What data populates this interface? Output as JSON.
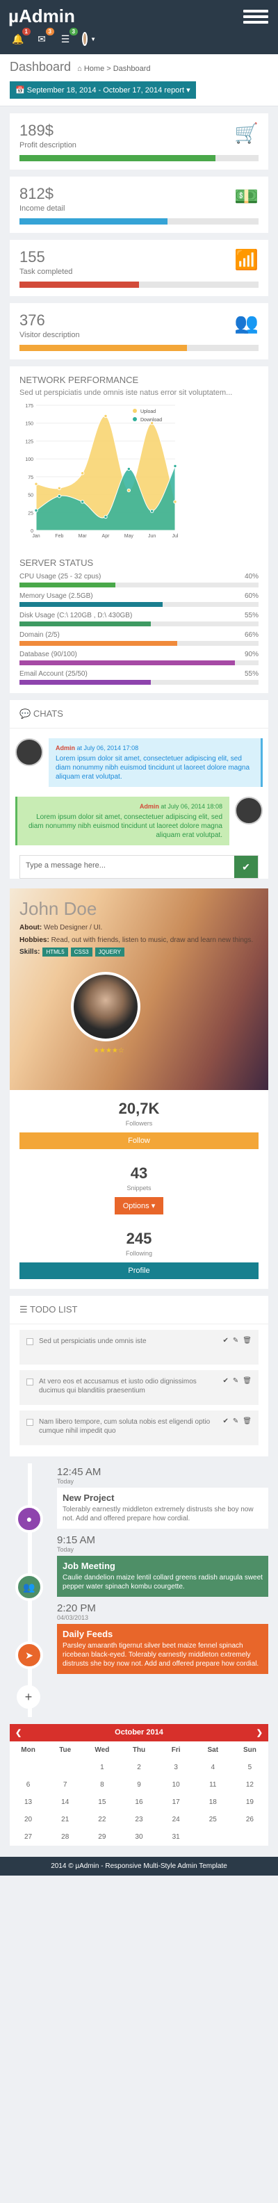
{
  "header": {
    "logo": "µAdmin",
    "notif_count": "1",
    "mail_count": "3",
    "task_count": "3"
  },
  "page": {
    "title": "Dashboard",
    "breadcrumb": [
      "Home",
      "Dashboard"
    ],
    "daterange": "September 18, 2014 - October 17, 2014 report"
  },
  "stats": [
    {
      "value": "189$",
      "label": "Profit description",
      "progress": 0.82,
      "color": "#4aa84a",
      "icon": "cart-icon"
    },
    {
      "value": "812$",
      "label": "Income detail",
      "progress": 0.62,
      "color": "#35a3d6",
      "icon": "money-icon"
    },
    {
      "value": "155",
      "label": "Task completed",
      "progress": 0.5,
      "color": "#d24a39",
      "icon": "signal-icon"
    },
    {
      "value": "376",
      "label": "Visitor description",
      "progress": 0.7,
      "color": "#f3a638",
      "icon": "users-icon"
    }
  ],
  "network": {
    "title": "NETWORK PERFORMANCE",
    "desc": "Sed ut perspiciatis unde omnis iste natus error sit voluptatem..."
  },
  "chart_data": {
    "type": "area",
    "categories": [
      "Jan",
      "Feb",
      "Mar",
      "Apr",
      "May",
      "Jun",
      "Jul"
    ],
    "series": [
      {
        "name": "Upload",
        "color": "#f8d26a",
        "values": [
          65,
          59,
          80,
          160,
          56,
          150,
          40
        ]
      },
      {
        "name": "Download",
        "color": "#2fb09a",
        "values": [
          28,
          48,
          40,
          19,
          86,
          27,
          90
        ]
      }
    ],
    "yticks": [
      0,
      25,
      50,
      75,
      100,
      125,
      150,
      175
    ],
    "ylim": [
      0,
      175
    ],
    "legend": "top-right"
  },
  "server": {
    "title": "SERVER STATUS",
    "rows": [
      {
        "label": "CPU Usage (25 - 32 cpus)",
        "pct": "40%",
        "v": 0.4,
        "color": "#4aa84a"
      },
      {
        "label": "Memory Usage (2.5GB)",
        "pct": "60%",
        "v": 0.6,
        "color": "#1a7e8f"
      },
      {
        "label": "Disk Usage (C:\\ 120GB , D:\\ 430GB)",
        "pct": "55%",
        "v": 0.55,
        "color": "#3e9a62"
      },
      {
        "label": "Domain (2/5)",
        "pct": "66%",
        "v": 0.66,
        "color": "#f08a3b"
      },
      {
        "label": "Database (90/100)",
        "pct": "90%",
        "v": 0.9,
        "color": "#a64aa5"
      },
      {
        "label": "Email Account (25/50)",
        "pct": "55%",
        "v": 0.55,
        "color": "#8e44ad"
      }
    ]
  },
  "chats": {
    "title": "CHATS",
    "messages": [
      {
        "author": "Admin",
        "time": "at July 06, 2014 17:08",
        "text": "Lorem ipsum dolor sit amet, consectetuer adipiscing elit, sed diam nonummy nibh euismod tincidunt ut laoreet dolore magna aliquam erat volutpat."
      },
      {
        "author": "Admin",
        "time": "at July 06, 2014 18:08",
        "text": "Lorem ipsum dolor sit amet, consectetuer adipiscing elit, sed diam nonummy nibh euismod tincidunt ut laoreet dolore magna aliquam erat volutpat."
      }
    ],
    "placeholder": "Type a message here..."
  },
  "profile": {
    "name": "John Doe",
    "about_label": "About:",
    "about": "Web Designer / UI.",
    "hobbies_label": "Hobbies:",
    "hobbies": "Read, out with friends, listen to music, draw and learn new things.",
    "skills_label": "Skills:",
    "skills": [
      "HTML5",
      "CSS3",
      "JQUERY"
    ],
    "rating": 4,
    "followers": "20,7K",
    "followers_label": "Followers",
    "follow_btn": "Follow",
    "snippets": "43",
    "snippets_label": "Snippets",
    "options_btn": "Options",
    "following": "245",
    "following_label": "Following",
    "profile_btn": "Profile"
  },
  "todo": {
    "title": "TODO LIST",
    "items": [
      "Sed ut perspiciatis unde omnis iste",
      "At vero eos et accusamus et iusto odio dignissimos ducimus qui blanditiis praesentium",
      "Nam libero tempore, cum soluta nobis est eligendi optio cumque nihil impedit quo"
    ]
  },
  "timeline": [
    {
      "time": "12:45 AM",
      "day": "Today",
      "title": "New Project",
      "text": "Tolerably earnestly middleton extremely distrusts she boy now not. Add and offered prepare how cordial.",
      "style": "plain",
      "dot": "#8e44ad"
    },
    {
      "time": "9:15 AM",
      "day": "Today",
      "title": "Job Meeting",
      "text": "Caulie dandelion maize lentil collard greens radish arugula sweet pepper water spinach kombu courgette.",
      "style": "green",
      "dot": "#4e8f67"
    },
    {
      "time": "2:20 PM",
      "day": "04/03/2013",
      "title": "Daily Feeds",
      "text": "Parsley amaranth tigernut silver beet maize fennel spinach ricebean black-eyed. Tolerably earnestly middleton extremely distrusts she boy now not. Add and offered prepare how cordial.",
      "style": "orange",
      "dot": "#e8662a"
    }
  ],
  "calendar": {
    "month": "October 2014",
    "days": [
      "Mon",
      "Tue",
      "Wed",
      "Thu",
      "Fri",
      "Sat",
      "Sun"
    ],
    "cells": [
      "",
      "",
      "1",
      "2",
      "3",
      "4",
      "5",
      "6",
      "7",
      "8",
      "9",
      "10",
      "11",
      "12",
      "13",
      "14",
      "15",
      "16",
      "17",
      "18",
      "19",
      "20",
      "21",
      "22",
      "23",
      "24",
      "25",
      "26",
      "27",
      "28",
      "29",
      "30",
      "31",
      "",
      ""
    ]
  },
  "footer": "2014 © µAdmin - Responsive Multi-Style Admin Template"
}
